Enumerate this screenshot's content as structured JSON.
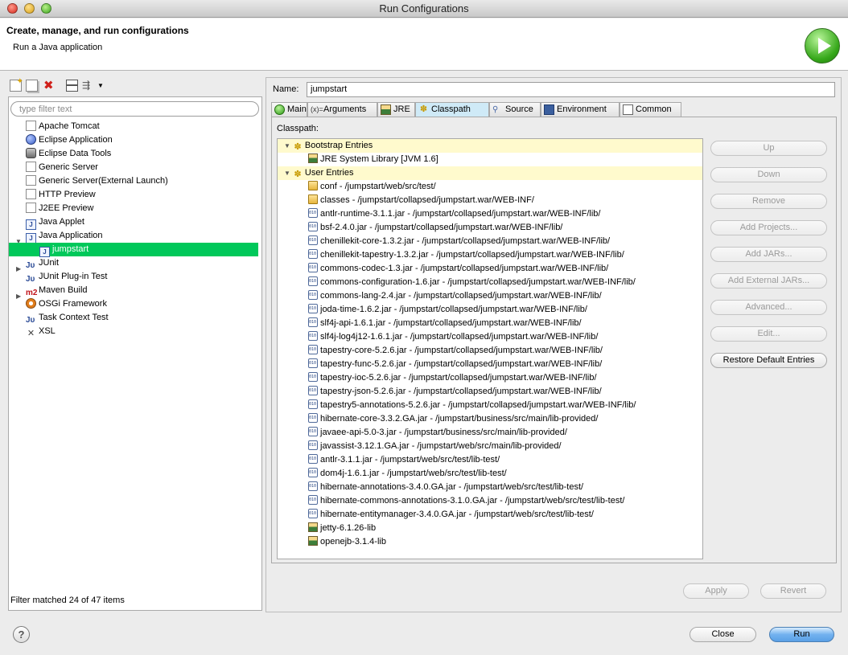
{
  "window": {
    "title": "Run Configurations"
  },
  "header": {
    "title": "Create, manage, and run configurations",
    "subtitle": "Run a Java application"
  },
  "left": {
    "filter_placeholder": "type filter text",
    "tree": [
      {
        "label": "Apache Tomcat",
        "icon": "page-icon"
      },
      {
        "label": "Eclipse Application",
        "icon": "globe-icon"
      },
      {
        "label": "Eclipse Data Tools",
        "icon": "disk-icon"
      },
      {
        "label": "Generic Server",
        "icon": "page-icon"
      },
      {
        "label": "Generic Server(External Launch)",
        "icon": "page-icon"
      },
      {
        "label": "HTTP Preview",
        "icon": "page-icon"
      },
      {
        "label": "J2EE Preview",
        "icon": "page-icon"
      },
      {
        "label": "Java Applet",
        "icon": "applet-icon"
      },
      {
        "label": "Java Application",
        "icon": "java-app-icon",
        "expanded": true
      },
      {
        "label": "jumpstart",
        "icon": "java-app-icon",
        "selected": true
      },
      {
        "label": "JUnit",
        "icon": "junit-icon",
        "collapsed": true
      },
      {
        "label": "JUnit Plug-in Test",
        "icon": "junit-icon"
      },
      {
        "label": "Maven Build",
        "icon": "maven-icon",
        "collapsed": true
      },
      {
        "label": "OSGi Framework",
        "icon": "osgi-icon"
      },
      {
        "label": "Task Context Test",
        "icon": "junit-icon"
      },
      {
        "label": "XSL",
        "icon": "xsl-icon"
      }
    ],
    "status": "Filter matched 24 of 47 items"
  },
  "right": {
    "name_label": "Name:",
    "name_value": "jumpstart",
    "tabs": [
      {
        "label": "Main",
        "icon": "main-icon"
      },
      {
        "label": "Arguments",
        "icon": "arguments-icon"
      },
      {
        "label": "JRE",
        "icon": "jre-icon"
      },
      {
        "label": "Classpath",
        "icon": "classpath-icon",
        "active": true
      },
      {
        "label": "Source",
        "icon": "source-icon"
      },
      {
        "label": "Environment",
        "icon": "environment-icon"
      },
      {
        "label": "Common",
        "icon": "common-icon"
      }
    ],
    "classpath_label": "Classpath:",
    "bootstrap_label": "Bootstrap Entries",
    "bootstrap_entries": [
      "JRE System Library [JVM 1.6]"
    ],
    "user_label": "User Entries",
    "user_entries": [
      {
        "label": "conf - /jumpstart/web/src/test/",
        "icon": "folder"
      },
      {
        "label": "classes - /jumpstart/collapsed/jumpstart.war/WEB-INF/",
        "icon": "folder"
      },
      {
        "label": "antlr-runtime-3.1.1.jar - /jumpstart/collapsed/jumpstart.war/WEB-INF/lib/",
        "icon": "jar"
      },
      {
        "label": "bsf-2.4.0.jar - /jumpstart/collapsed/jumpstart.war/WEB-INF/lib/",
        "icon": "jar"
      },
      {
        "label": "chenillekit-core-1.3.2.jar - /jumpstart/collapsed/jumpstart.war/WEB-INF/lib/",
        "icon": "jar"
      },
      {
        "label": "chenillekit-tapestry-1.3.2.jar - /jumpstart/collapsed/jumpstart.war/WEB-INF/lib/",
        "icon": "jar"
      },
      {
        "label": "commons-codec-1.3.jar - /jumpstart/collapsed/jumpstart.war/WEB-INF/lib/",
        "icon": "jar"
      },
      {
        "label": "commons-configuration-1.6.jar - /jumpstart/collapsed/jumpstart.war/WEB-INF/lib/",
        "icon": "jar"
      },
      {
        "label": "commons-lang-2.4.jar - /jumpstart/collapsed/jumpstart.war/WEB-INF/lib/",
        "icon": "jar"
      },
      {
        "label": "joda-time-1.6.2.jar - /jumpstart/collapsed/jumpstart.war/WEB-INF/lib/",
        "icon": "jar"
      },
      {
        "label": "slf4j-api-1.6.1.jar - /jumpstart/collapsed/jumpstart.war/WEB-INF/lib/",
        "icon": "jar"
      },
      {
        "label": "slf4j-log4j12-1.6.1.jar - /jumpstart/collapsed/jumpstart.war/WEB-INF/lib/",
        "icon": "jar"
      },
      {
        "label": "tapestry-core-5.2.6.jar - /jumpstart/collapsed/jumpstart.war/WEB-INF/lib/",
        "icon": "jar"
      },
      {
        "label": "tapestry-func-5.2.6.jar - /jumpstart/collapsed/jumpstart.war/WEB-INF/lib/",
        "icon": "jar"
      },
      {
        "label": "tapestry-ioc-5.2.6.jar - /jumpstart/collapsed/jumpstart.war/WEB-INF/lib/",
        "icon": "jar"
      },
      {
        "label": "tapestry-json-5.2.6.jar - /jumpstart/collapsed/jumpstart.war/WEB-INF/lib/",
        "icon": "jar"
      },
      {
        "label": "tapestry5-annotations-5.2.6.jar - /jumpstart/collapsed/jumpstart.war/WEB-INF/lib/",
        "icon": "jar"
      },
      {
        "label": "hibernate-core-3.3.2.GA.jar - /jumpstart/business/src/main/lib-provided/",
        "icon": "jar"
      },
      {
        "label": "javaee-api-5.0-3.jar - /jumpstart/business/src/main/lib-provided/",
        "icon": "jar"
      },
      {
        "label": "javassist-3.12.1.GA.jar - /jumpstart/web/src/main/lib-provided/",
        "icon": "jar"
      },
      {
        "label": "antlr-3.1.1.jar - /jumpstart/web/src/test/lib-test/",
        "icon": "jar"
      },
      {
        "label": "dom4j-1.6.1.jar - /jumpstart/web/src/test/lib-test/",
        "icon": "jar"
      },
      {
        "label": "hibernate-annotations-3.4.0.GA.jar - /jumpstart/web/src/test/lib-test/",
        "icon": "jar"
      },
      {
        "label": "hibernate-commons-annotations-3.1.0.GA.jar - /jumpstart/web/src/test/lib-test/",
        "icon": "jar"
      },
      {
        "label": "hibernate-entitymanager-3.4.0.GA.jar - /jumpstart/web/src/test/lib-test/",
        "icon": "jar"
      },
      {
        "label": "jetty-6.1.26-lib",
        "icon": "library"
      },
      {
        "label": "openejb-3.1.4-lib",
        "icon": "library"
      }
    ],
    "side_buttons": [
      {
        "label": "Up",
        "enabled": false
      },
      {
        "label": "Down",
        "enabled": false
      },
      {
        "label": "Remove",
        "enabled": false
      },
      {
        "label": "Add Projects...",
        "enabled": false
      },
      {
        "label": "Add JARs...",
        "enabled": false
      },
      {
        "label": "Add External JARs...",
        "enabled": false
      },
      {
        "label": "Advanced...",
        "enabled": false
      },
      {
        "label": "Edit...",
        "enabled": false
      },
      {
        "label": "Restore Default Entries",
        "enabled": true
      }
    ],
    "apply_label": "Apply",
    "revert_label": "Revert"
  },
  "footer": {
    "help_glyph": "?",
    "close_label": "Close",
    "run_label": "Run"
  }
}
